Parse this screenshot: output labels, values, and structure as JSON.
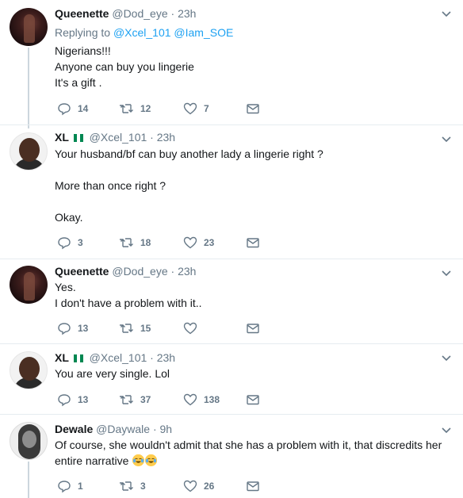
{
  "tweets": [
    {
      "name": "Queenette",
      "handle": "@Dod_eye",
      "time": "23h",
      "replying_label": "Replying to",
      "replying_to": [
        "@Xcel_101",
        "@Iam_SOE"
      ],
      "text": "Nigerians!!!\nAnyone can buy you lingerie\nIt's a gift .",
      "replies": "14",
      "retweets": "12",
      "likes": "7"
    },
    {
      "name": "XL",
      "flag_colors": [
        "#008751",
        "#ffffff",
        "#008751"
      ],
      "handle": "@Xcel_101",
      "time": "23h",
      "text": "Your husband/bf can buy another lady a lingerie right ?\n\nMore than once right ?\n\nOkay.",
      "replies": "3",
      "retweets": "18",
      "likes": "23"
    },
    {
      "name": "Queenette",
      "handle": "@Dod_eye",
      "time": "23h",
      "text": "Yes.\nI don't have a problem with it..",
      "replies": "13",
      "retweets": "15",
      "likes": ""
    },
    {
      "name": "XL",
      "flag_colors": [
        "#008751",
        "#ffffff",
        "#008751"
      ],
      "handle": "@Xcel_101",
      "time": "23h",
      "text": "You are very single. Lol",
      "replies": "13",
      "retweets": "37",
      "likes": "138"
    },
    {
      "name": "Dewale",
      "handle": "@Daywale",
      "time": "9h",
      "text": "Of course, she wouldn't admit that she has a problem with it,  that discredits her\nentire narrative",
      "emoji": [
        "face-with-tears-of-joy",
        "face-with-tears-of-joy"
      ],
      "replies": "1",
      "retweets": "3",
      "likes": "26"
    }
  ],
  "separator": "·",
  "icons": {
    "reply": "reply-icon",
    "retweet": "retweet-icon",
    "like": "heart-icon",
    "dm": "envelope-icon",
    "more": "chevron-down-icon"
  },
  "colors": {
    "link": "#1da1f2",
    "muted": "#657786",
    "thread": "#ccd6dd"
  }
}
